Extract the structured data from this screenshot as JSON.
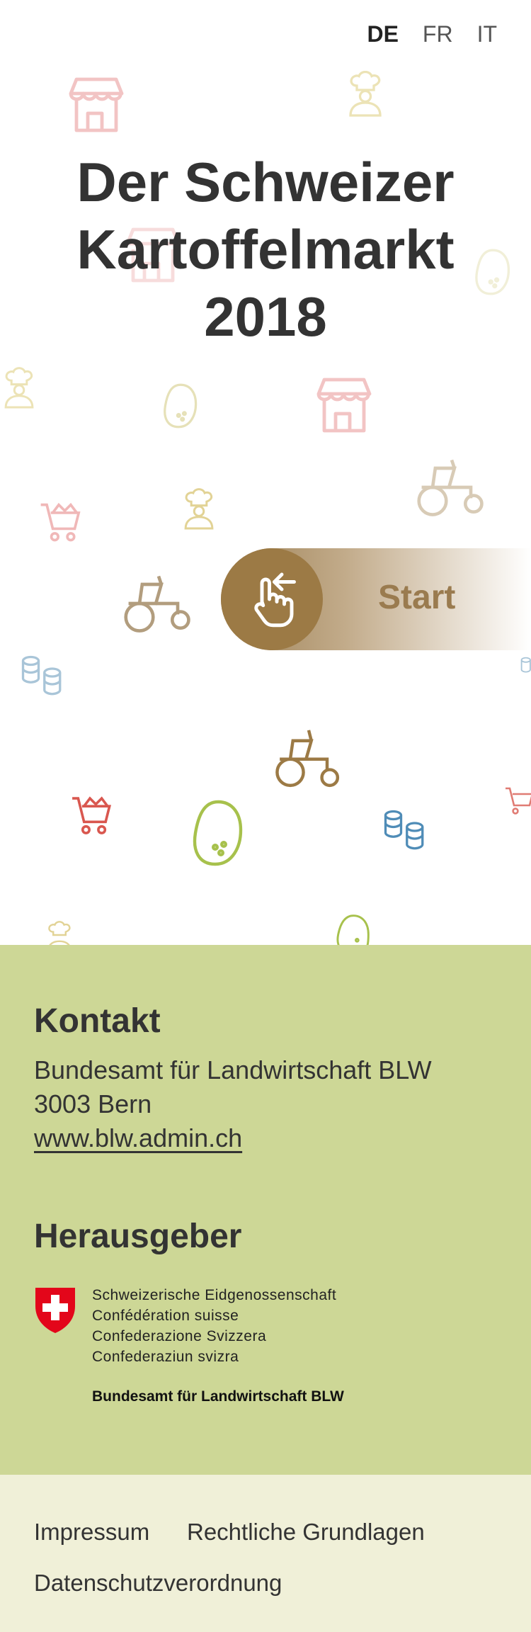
{
  "languages": {
    "de": "DE",
    "fr": "FR",
    "it": "IT",
    "active": "DE"
  },
  "title": {
    "line1": "Der Schweizer",
    "line2": "Kartoffelmarkt",
    "line3": "2018"
  },
  "start": {
    "label": "Start",
    "icon": "swipe-left-hand-icon"
  },
  "kontakt": {
    "heading": "Kontakt",
    "office": "Bundesamt für Landwirtschaft BLW",
    "city": "3003 Bern",
    "website": "www.blw.admin.ch"
  },
  "herausgeber": {
    "heading": "Herausgeber",
    "confederation": [
      "Schweizerische Eidgenossenschaft",
      "Confédération suisse",
      "Confederazione Svizzera",
      "Confederaziun svizra"
    ],
    "office": "Bundesamt für Landwirtschaft BLW"
  },
  "footer": {
    "impressum": "Impressum",
    "grundlagen": "Rechtliche Grundlagen",
    "datenschutz": "Datenschutzverordnung"
  },
  "colors": {
    "accent": "#9c7a45",
    "contact_bg": "#cdd796",
    "footer_bg": "#f0f0d8",
    "swiss_red": "#e3061a"
  }
}
